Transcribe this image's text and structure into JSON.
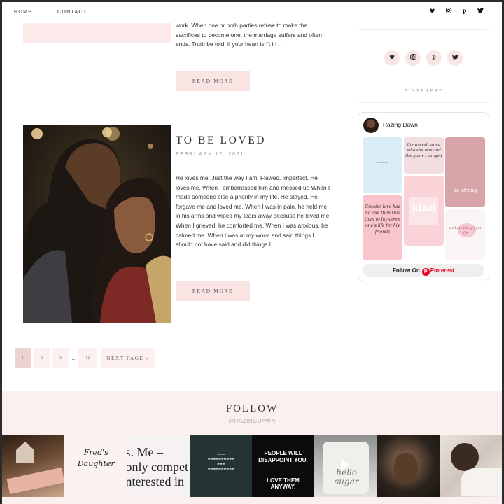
{
  "nav": {
    "home": "HOME",
    "contact": "CONTACT"
  },
  "nav_icons": [
    "heart-icon",
    "instagram-icon",
    "pinterest-icon",
    "twitter-icon"
  ],
  "post1": {
    "excerpt": "work. When one or both parties refuse to make the sacrifices to become one, the marriage suffers and often ends.  Truth be told, if your heart isn't in …",
    "read_more": "READ MORE"
  },
  "post2": {
    "title": "TO BE LOVED",
    "date": "FEBRUARY 12, 2021",
    "excerpt": "He loves me. Just the way I am. Flawed. Imperfect. He loves me.  When I embarrassed him and messed up When I made someone else a priority in my life. He stayed. He forgave me  and loved me. When I was in pain, he held me in his arms and wiped my tears away because he loved me.  When I grieved, he comforted me. When I was anxious, he calmed me. When I was at my worst and said things I should not have said and did things I …",
    "read_more": "READ MORE"
  },
  "pagination": {
    "pages": [
      "1",
      "2",
      "3"
    ],
    "ellipsis": "…",
    "last": "12",
    "next": "NEXT PAGE »"
  },
  "sidebar": {
    "social_icons": [
      "heart-icon",
      "instagram-icon",
      "pinterest-icon",
      "twitter-icon"
    ],
    "pinterest_heading": "PINTEREST",
    "widget": {
      "account": "Razing Dawn",
      "pins": [
        "Greater love has no one than this than to lay down one's life for his friends",
        "the unrestrained who she was and the game changed",
        "be strong",
        "kind",
        "a whole lot of your life"
      ],
      "follow_prefix": "Follow On",
      "follow_brand": "Pinterest"
    }
  },
  "follow": {
    "title": "FOLLOW",
    "handle": "@RAZINGDAWN",
    "tiles": {
      "tile2": "Fred's Daughter",
      "tile3_line1": "s. Me –",
      "tile3_line2": "only compet",
      "tile3_line3": "nterested in",
      "tile5_line1": "PEOPLE WILL DISAPPOINT YOU.",
      "tile5_line2": "LOVE THEM ANYWAY.",
      "tile6": "hello sugar"
    }
  },
  "colors": {
    "accent_pink": "#f8e4e3",
    "follow_bg": "#fcf0ef",
    "pinterest_red": "#e60023"
  }
}
